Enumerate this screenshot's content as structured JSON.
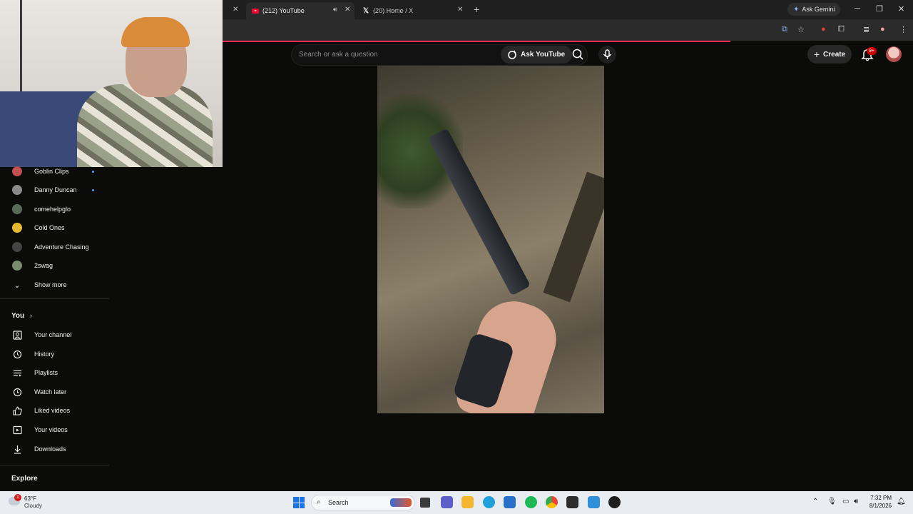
{
  "browser": {
    "tabs": [
      {
        "title": "(212) YouTube",
        "active": true
      },
      {
        "title": "(20) Home / X",
        "active": false
      }
    ],
    "ask_gemini_label": "Ask Gemini"
  },
  "header": {
    "search_placeholder": "Search or ask a question",
    "ask_youtube_label": "Ask YouTube",
    "create_label": "Create",
    "notification_count": "9+"
  },
  "sidebar": {
    "subscriptions": [
      {
        "label": "Goblin Clips",
        "new": true
      },
      {
        "label": "Danny Duncan",
        "new": true
      },
      {
        "label": "comehelpglo",
        "new": false
      },
      {
        "label": "Cold Ones",
        "new": false
      },
      {
        "label": "Adventure Chasing",
        "new": false
      },
      {
        "label": "2swag",
        "new": false
      }
    ],
    "show_more_label": "Show more",
    "you_heading": "You",
    "you_items": [
      {
        "label": "Your channel",
        "icon": "channel-icon"
      },
      {
        "label": "History",
        "icon": "history-icon"
      },
      {
        "label": "Playlists",
        "icon": "playlists-icon"
      },
      {
        "label": "Watch later",
        "icon": "watch-later-icon"
      },
      {
        "label": "Liked videos",
        "icon": "like-icon"
      },
      {
        "label": "Your videos",
        "icon": "your-videos-icon"
      },
      {
        "label": "Downloads",
        "icon": "download-icon"
      }
    ],
    "explore_heading": "Explore"
  },
  "taskbar": {
    "weather_temp": "63°F",
    "weather_desc": "Cloudy",
    "weather_badge": "1",
    "search_label": "Search",
    "time": "7:32 PM",
    "date": "8/1/2026"
  },
  "colors": {
    "accent_red": "#ff0033",
    "background": "#0f0f0f",
    "unread_dot": "#3ea6ff"
  }
}
